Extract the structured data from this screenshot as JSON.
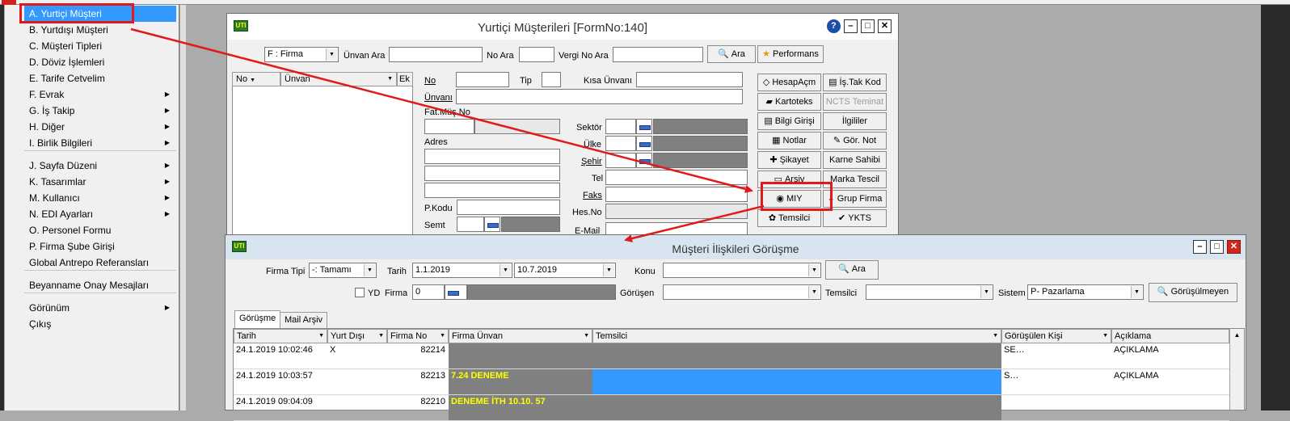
{
  "menu": {
    "items": [
      {
        "label": "A.  Yurtiçi Müşteri",
        "submenu": false,
        "selected": true
      },
      {
        "label": "B.  Yurtdışı Müşteri",
        "submenu": false
      },
      {
        "label": "C.  Müşteri Tipleri",
        "submenu": false
      },
      {
        "label": "D.  Döviz İşlemleri",
        "submenu": false
      },
      {
        "label": "E.  Tarife Cetvelim",
        "submenu": false
      },
      {
        "label": "F.  Evrak",
        "submenu": true
      },
      {
        "label": "G.  İş Takip",
        "submenu": true
      },
      {
        "label": "H.  Diğer",
        "submenu": true
      },
      {
        "label": "I.  Birlik Bilgileri",
        "submenu": true
      },
      {
        "label": "J.  Sayfa Düzeni",
        "submenu": true
      },
      {
        "label": "K.  Tasarımlar",
        "submenu": true
      },
      {
        "label": "M.  Kullanıcı",
        "submenu": true
      },
      {
        "label": "N.  EDI Ayarları",
        "submenu": true
      },
      {
        "label": "O.  Personel Formu",
        "submenu": false
      },
      {
        "label": "P.  Firma Şube Girişi",
        "submenu": false
      },
      {
        "label": "Global Antrepo Referansları",
        "submenu": false
      },
      {
        "label": "Beyanname Onay Mesajları",
        "submenu": false
      },
      {
        "label": "Görünüm",
        "submenu": true
      },
      {
        "label": "Çıkış",
        "submenu": false
      }
    ],
    "arrow_glyph": "▶"
  },
  "win1": {
    "title": "Yurtiçi Müşterileri [FormNo:140]",
    "logo_text": "UTI",
    "firma_select": "F : Firma",
    "unvan_ara_label": "Ünvan Ara",
    "no_ara_label": "No Ara",
    "vergi_no_ara_label": "Vergi No Ara",
    "ara_button": "Ara",
    "performans_button": "Performans",
    "list_headers": {
      "no": "No",
      "unvan": "Ünvan",
      "ek": "Ek"
    },
    "labels": {
      "no": "No",
      "tip": "Tip",
      "kisa_unvani": "Kısa Ünvanı",
      "unvani": "Ünvanı",
      "fat_mus_no": "Fat.Müş.No",
      "sektor": "Sektör",
      "adres": "Adres",
      "ulke": "Ülke",
      "sehir": "Şehir",
      "tel": "Tel",
      "faks": "Faks",
      "p_kodu": "P.Kodu",
      "hes_no": "Hes.No",
      "semt": "Semt",
      "e_mail": "E-Mail"
    },
    "side_buttons": [
      {
        "label": "HesapAçm",
        "icon": "◇"
      },
      {
        "label": "İş.Tak Kod",
        "icon": "▤"
      },
      {
        "label": "Kartoteks",
        "icon": "▰"
      },
      {
        "label": "NCTS Teminat",
        "icon": ""
      },
      {
        "label": "Bilgi Girişi",
        "icon": "▤"
      },
      {
        "label": "İlgililer",
        "icon": ""
      },
      {
        "label": "Notlar",
        "icon": "▦"
      },
      {
        "label": "Gör. Not",
        "icon": "✎"
      },
      {
        "label": "Şikayet",
        "icon": "✚"
      },
      {
        "label": "Karne Sahibi",
        "icon": ""
      },
      {
        "label": "Arşiv",
        "icon": "▭"
      },
      {
        "label": "Marka Tescil",
        "icon": ""
      },
      {
        "label": "MIY",
        "icon": "◉"
      },
      {
        "label": "Grup Firma",
        "icon": "⇩"
      },
      {
        "label": "Temsilci",
        "icon": "✿"
      },
      {
        "label": "YKTS",
        "icon": "✔"
      }
    ]
  },
  "win2": {
    "title": "Müşteri İlişkileri Görüşme",
    "logo_text": "UTI",
    "firma_tipi_label": "Firma Tipi",
    "firma_tipi_value": "-: Tamamı",
    "tarih_label": "Tarih",
    "tarih_from": "1.1.2019",
    "tarih_to": "10.7.2019",
    "konu_label": "Konu",
    "ara_button": "Ara",
    "yd_label": "YD",
    "firma_label": "Firma",
    "firma_value": "0",
    "gorusen_label": "Görüşen",
    "temsilci_label": "Temsilci",
    "sistem_label": "Sistem",
    "sistem_value": "P- Pazarlama",
    "gorusulmeyen_button": "Görüşülmeyen",
    "tabs": [
      "Görüşme",
      "Mail Arşiv"
    ],
    "columns": [
      "Tarih",
      "Yurt Dışı",
      "Firma No",
      "Firma Ünvan",
      "Temsilci",
      "Görüşülen Kişi",
      "Açıklama"
    ],
    "rows": [
      {
        "tarih": "24.1.2019 10:02:46",
        "yurt_disi": "X",
        "firma_no": "82214",
        "firma_unvan": "",
        "temsilci": "",
        "gorusulen": "SE…",
        "aciklama": "AÇIKLAMA"
      },
      {
        "tarih": "24.1.2019 10:03:57",
        "yurt_disi": "",
        "firma_no": "82213",
        "firma_unvan": "7.24 DENEME",
        "temsilci": "",
        "gorusulen": "S…",
        "aciklama": "AÇIKLAMA"
      },
      {
        "tarih": "24.1.2019 09:04:09",
        "yurt_disi": "",
        "firma_no": "82210",
        "firma_unvan": "DENEME İTH 10.10. 57",
        "temsilci": "",
        "gorusulen": "",
        "aciklama": ""
      }
    ]
  },
  "colors": {
    "highlight": "#3399ff",
    "annotation_red": "#e01a1a",
    "grid_gray": "#808080",
    "row_yellow": "#ffff00"
  }
}
